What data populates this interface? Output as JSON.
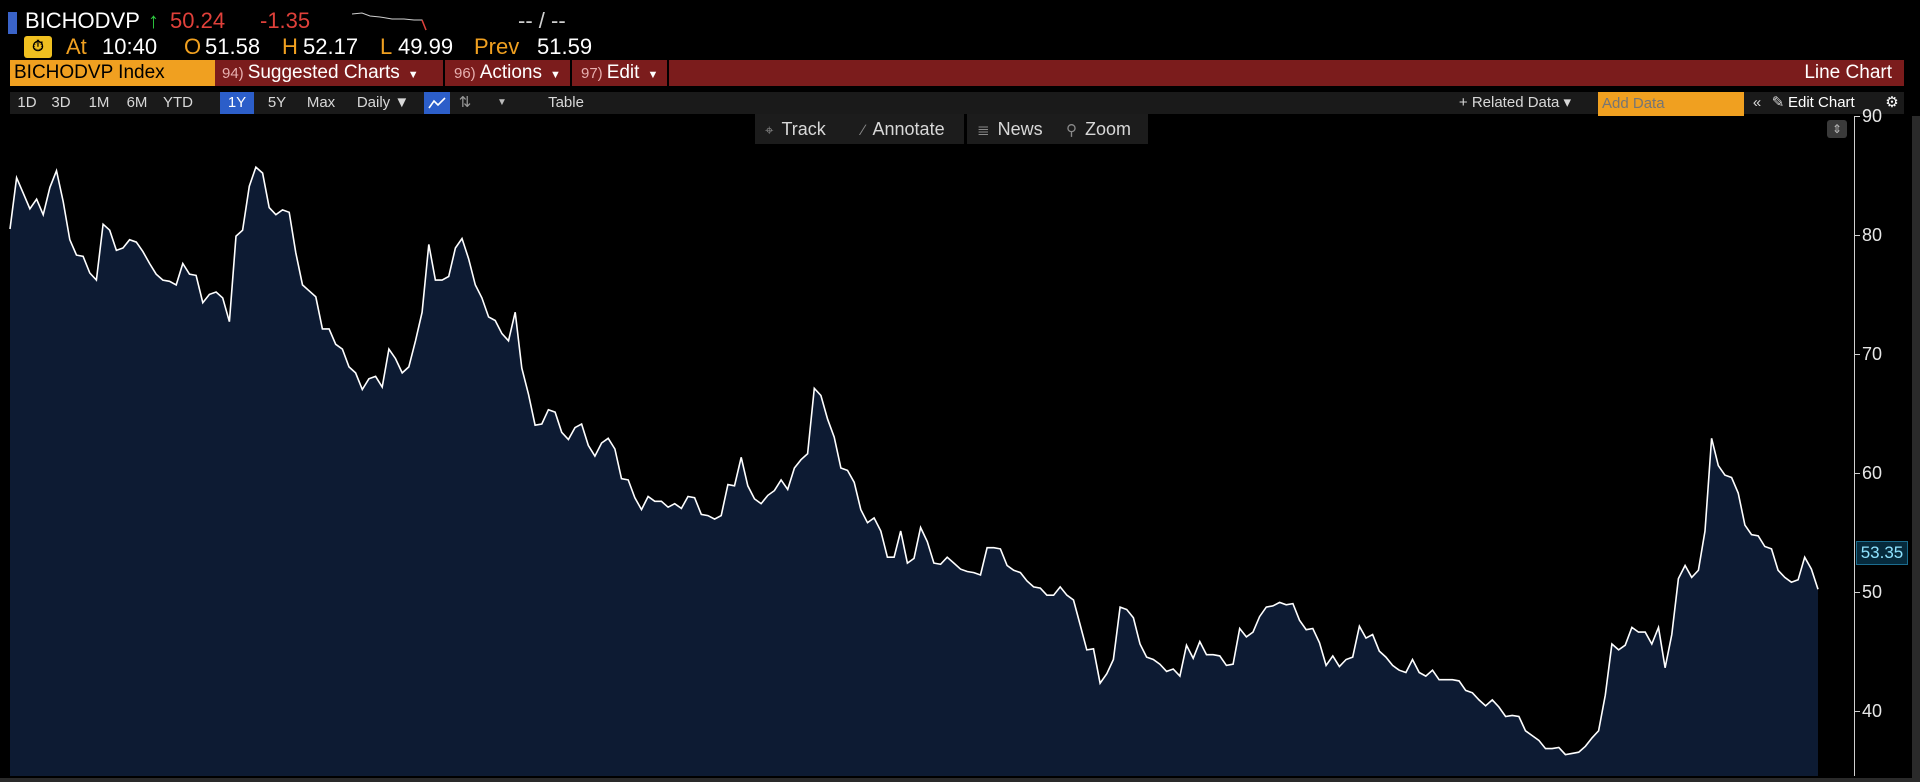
{
  "quote": {
    "ticker": "BICHODVP",
    "arrow": "↑",
    "last": "50.24",
    "change": "-1.35",
    "bidask": "-- / --",
    "time_label": "At",
    "time": "10:40",
    "open_label": "O",
    "open": "51.58",
    "high_label": "H",
    "high": "52.17",
    "low_label": "L",
    "low": "49.99",
    "prev_label": "Prev",
    "prev": "51.59"
  },
  "menu": {
    "security": "BICHODVP Index",
    "suggested_num": "94)",
    "suggested": "Suggested Charts",
    "actions_num": "96)",
    "actions": "Actions",
    "edit_num": "97)",
    "edit": "Edit",
    "chart_type": "Line Chart"
  },
  "toolbar": {
    "ranges": [
      "1D",
      "3D",
      "1M",
      "6M",
      "YTD",
      "1Y",
      "5Y",
      "Max"
    ],
    "active_range": "1Y",
    "frequency": "Daily ▼",
    "table": "Table",
    "related": "+ Related Data ▾",
    "add_data_placeholder": "Add Data",
    "edit_chart": "Edit Chart"
  },
  "tools": {
    "track": "Track",
    "annotate": "Annotate",
    "news": "News",
    "zoom": "Zoom"
  },
  "colors": {
    "line": "#ffffff",
    "fill": "#0d1b33",
    "up": "#2ecc40",
    "down": "#e0403a",
    "accent": "#f0a020"
  },
  "chart_data": {
    "type": "area",
    "y_ticks": [
      40,
      50,
      60,
      70,
      80,
      90
    ],
    "ylim": [
      34.5,
      90
    ],
    "last_value_tag": "53.35",
    "values": [
      80.5,
      84.8,
      83.5,
      82.2,
      83.0,
      81.7,
      84.0,
      85.4,
      82.8,
      79.6,
      78.3,
      78.2,
      76.8,
      76.2,
      80.9,
      80.4,
      78.7,
      78.9,
      79.6,
      79.4,
      78.6,
      77.6,
      76.7,
      76.2,
      76.1,
      75.8,
      77.6,
      76.7,
      76.6,
      74.3,
      75.0,
      75.2,
      74.7,
      72.7,
      79.9,
      80.4,
      84.1,
      85.7,
      85.2,
      82.3,
      81.7,
      82.1,
      81.9,
      78.5,
      75.8,
      75.3,
      74.8,
      72.1,
      72.1,
      70.8,
      70.4,
      68.9,
      68.4,
      67.0,
      67.9,
      68.1,
      67.2,
      70.4,
      69.6,
      68.4,
      68.9,
      71.1,
      73.5,
      79.2,
      76.2,
      76.2,
      76.5,
      78.9,
      79.7,
      78.0,
      75.8,
      74.7,
      73.1,
      72.8,
      71.7,
      71.1,
      73.5,
      68.8,
      66.6,
      64.0,
      64.1,
      65.3,
      65.1,
      63.4,
      62.8,
      63.8,
      64.1,
      62.3,
      61.4,
      62.5,
      62.9,
      62.0,
      59.5,
      59.4,
      57.9,
      56.9,
      58.0,
      57.6,
      57.6,
      57.1,
      57.4,
      57.0,
      58.0,
      57.9,
      56.5,
      56.4,
      56.1,
      56.4,
      59.0,
      58.9,
      61.3,
      58.9,
      57.8,
      57.4,
      58.1,
      58.5,
      59.4,
      58.6,
      60.4,
      61.1,
      61.6,
      67.1,
      66.5,
      64.5,
      63.0,
      60.4,
      60.2,
      59.2,
      56.9,
      55.8,
      56.2,
      55.1,
      52.9,
      52.9,
      55.1,
      52.4,
      52.8,
      55.4,
      54.2,
      52.4,
      52.3,
      52.9,
      52.4,
      51.9,
      51.7,
      51.6,
      51.4,
      53.7,
      53.7,
      53.6,
      52.2,
      51.8,
      51.6,
      50.9,
      50.4,
      50.3,
      49.7,
      49.7,
      50.4,
      49.7,
      49.3,
      47.2,
      45.1,
      45.2,
      42.3,
      43.1,
      44.3,
      48.7,
      48.5,
      47.8,
      45.6,
      44.5,
      44.3,
      43.9,
      43.3,
      43.5,
      42.9,
      45.5,
      44.4,
      45.8,
      44.7,
      44.7,
      44.6,
      43.8,
      43.9,
      46.9,
      46.2,
      46.6,
      47.9,
      48.7,
      48.8,
      49.1,
      48.9,
      49.0,
      47.6,
      46.8,
      46.9,
      45.7,
      43.8,
      44.6,
      43.7,
      44.3,
      44.5,
      47.1,
      46.1,
      46.4,
      45.0,
      44.5,
      43.8,
      43.4,
      43.2,
      44.3,
      43.2,
      42.9,
      43.4,
      42.6,
      42.6,
      42.6,
      42.5,
      41.7,
      41.5,
      40.9,
      40.4,
      40.9,
      40.3,
      39.5,
      39.6,
      39.5,
      38.3,
      37.9,
      37.5,
      36.8,
      36.8,
      36.9,
      36.3,
      36.4,
      36.5,
      37.0,
      37.7,
      38.3,
      41.3,
      45.6,
      45.1,
      45.5,
      47.0,
      46.6,
      46.6,
      45.6,
      47.0,
      43.6,
      46.4,
      51.1,
      52.2,
      51.2,
      51.8,
      55.1,
      62.9,
      60.6,
      59.8,
      59.6,
      58.3,
      55.6,
      54.8,
      54.7,
      53.8,
      53.6,
      51.8,
      51.2,
      50.8,
      51.0,
      52.9,
      51.9,
      50.2
    ]
  }
}
